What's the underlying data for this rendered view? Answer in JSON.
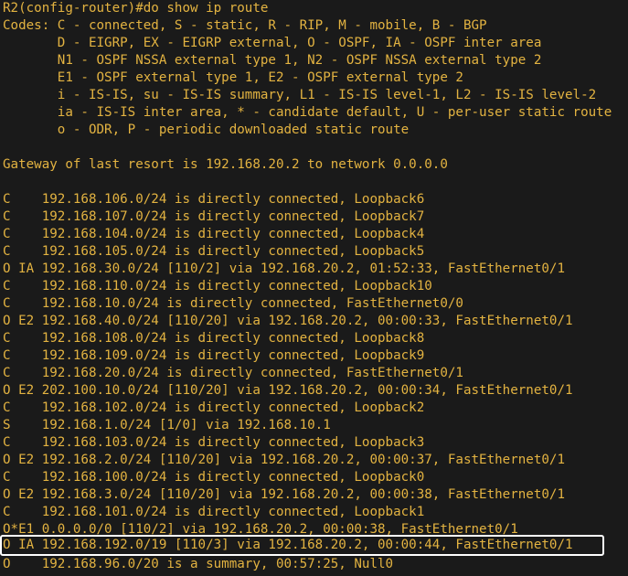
{
  "terminal": {
    "lines": [
      "R2(config-router)#do show ip route",
      "Codes: C - connected, S - static, R - RIP, M - mobile, B - BGP",
      "       D - EIGRP, EX - EIGRP external, O - OSPF, IA - OSPF inter area",
      "       N1 - OSPF NSSA external type 1, N2 - OSPF NSSA external type 2",
      "       E1 - OSPF external type 1, E2 - OSPF external type 2",
      "       i - IS-IS, su - IS-IS summary, L1 - IS-IS level-1, L2 - IS-IS level-2",
      "       ia - IS-IS inter area, * - candidate default, U - per-user static route",
      "       o - ODR, P - periodic downloaded static route",
      "",
      "Gateway of last resort is 192.168.20.2 to network 0.0.0.0",
      "",
      "C    192.168.106.0/24 is directly connected, Loopback6",
      "C    192.168.107.0/24 is directly connected, Loopback7",
      "C    192.168.104.0/24 is directly connected, Loopback4",
      "C    192.168.105.0/24 is directly connected, Loopback5",
      "O IA 192.168.30.0/24 [110/2] via 192.168.20.2, 01:52:33, FastEthernet0/1",
      "C    192.168.110.0/24 is directly connected, Loopback10",
      "C    192.168.10.0/24 is directly connected, FastEthernet0/0",
      "O E2 192.168.40.0/24 [110/20] via 192.168.20.2, 00:00:33, FastEthernet0/1",
      "C    192.168.108.0/24 is directly connected, Loopback8",
      "C    192.168.109.0/24 is directly connected, Loopback9",
      "C    192.168.20.0/24 is directly connected, FastEthernet0/1",
      "O E2 202.100.10.0/24 [110/20] via 192.168.20.2, 00:00:34, FastEthernet0/1",
      "C    192.168.102.0/24 is directly connected, Loopback2",
      "S    192.168.1.0/24 [1/0] via 192.168.10.1",
      "C    192.168.103.0/24 is directly connected, Loopback3",
      "O E2 192.168.2.0/24 [110/20] via 192.168.20.2, 00:00:37, FastEthernet0/1",
      "C    192.168.100.0/24 is directly connected, Loopback0",
      "O E2 192.168.3.0/24 [110/20] via 192.168.20.2, 00:00:38, FastEthernet0/1",
      "C    192.168.101.0/24 is directly connected, Loopback1",
      "O*E1 0.0.0.0/0 [110/2] via 192.168.20.2, 00:00:38, FastEthernet0/1",
      "O IA 192.168.192.0/19 [110/3] via 192.168.20.2, 00:00:44, FastEthernet0/1",
      "O    192.168.96.0/20 is a summary, 00:57:25, Null0"
    ]
  }
}
